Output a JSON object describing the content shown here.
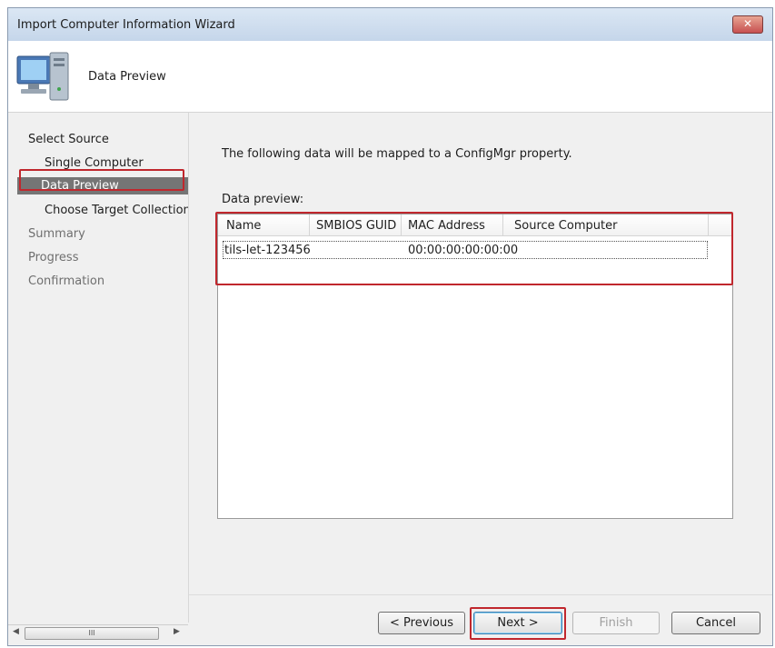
{
  "window": {
    "title": "Import Computer Information Wizard",
    "close_icon": "close-icon"
  },
  "header": {
    "title": "Data Preview",
    "icon": "computer-icon"
  },
  "nav": {
    "items": [
      {
        "label": "Select Source",
        "state": "normal"
      },
      {
        "label": "Single Computer",
        "state": "normal"
      },
      {
        "label": "Data Preview",
        "state": "selected"
      },
      {
        "label": "Choose Target Collection",
        "state": "normal"
      },
      {
        "label": "Summary",
        "state": "disabled"
      },
      {
        "label": "Progress",
        "state": "disabled"
      },
      {
        "label": "Confirmation",
        "state": "disabled"
      }
    ],
    "scrollbar_grip": "III"
  },
  "main": {
    "intro": "The following data will be mapped to a ConfigMgr property.",
    "preview_label": "Data preview:",
    "columns": [
      "Name",
      "SMBIOS GUID",
      "MAC Address",
      "Source Computer"
    ],
    "rows": [
      {
        "name": "tils-let-123456",
        "smbios_guid": "",
        "mac": "00:00:00:00:00:00",
        "source": ""
      }
    ]
  },
  "footer": {
    "previous": "< Previous",
    "next": "Next >",
    "finish": "Finish",
    "cancel": "Cancel"
  },
  "colors": {
    "highlight": "#c0272d",
    "selected_bg": "#757575"
  }
}
